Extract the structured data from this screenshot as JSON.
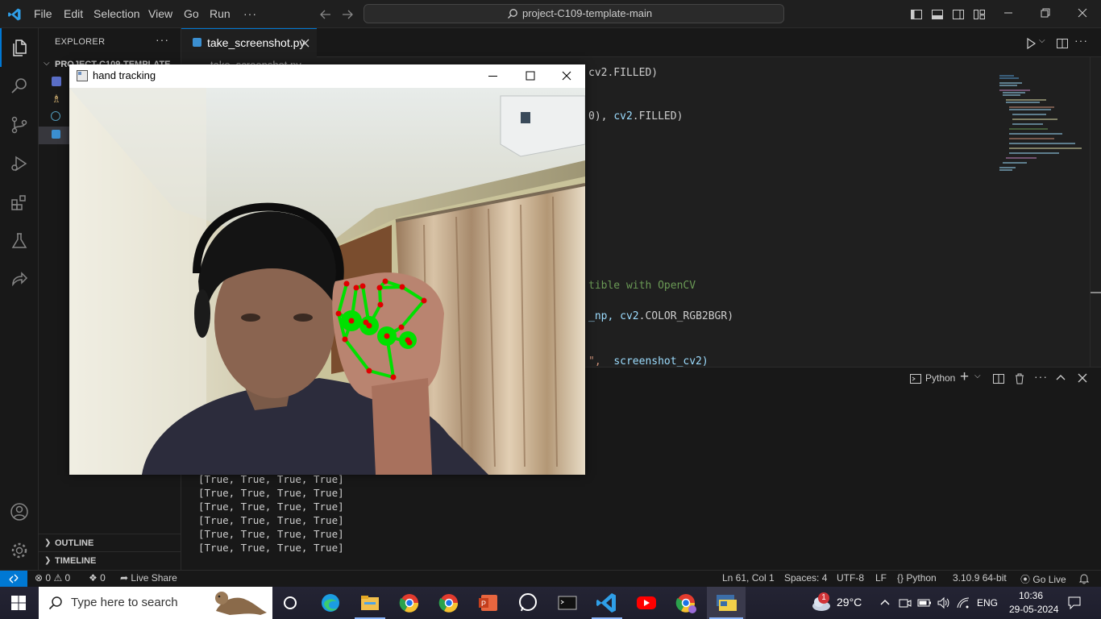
{
  "titlebar": {
    "menu": [
      "File",
      "Edit",
      "Selection",
      "View",
      "Go",
      "Run",
      "···"
    ],
    "search_text": "project-C109-template-main"
  },
  "sidebar": {
    "header": "EXPLORER",
    "project": "PROJECT-C109-TEMPLATE",
    "sections": [
      "OUTLINE",
      "TIMELINE"
    ]
  },
  "editor": {
    "tab_label": "take_screenshot.py",
    "breadcrumb": "take_screenshot.py",
    "code_lines": [
      {
        "segments": [
          {
            "text": "0), ",
            "color": "#cccccc"
          },
          {
            "text": "cv2",
            "color": "#9cdcfe"
          },
          {
            "text": ".FILLED)",
            "color": "#cccccc"
          }
        ]
      },
      {
        "segments": [
          {
            "text": "tible with OpenCV",
            "color": "#6a9955"
          }
        ]
      },
      {
        "segments": [
          {
            "text": "_np, ",
            "color": "#9cdcfe"
          },
          {
            "text": "cv2",
            "color": "#9cdcfe"
          },
          {
            "text": ".COLOR_RGB2BGR)",
            "color": "#cccccc"
          }
        ]
      },
      {
        "segments": [
          {
            "text": "\",  ",
            "color": "#ce9178"
          },
          {
            "text": "screenshot_cv2)",
            "color": "#9cdcfe"
          }
        ]
      }
    ]
  },
  "panel": {
    "terminal_kind": "Python",
    "lines": [
      "[True, True, True, True]",
      "[True, True, True, True]",
      "[True, True, True, True]",
      "[True, True, True, True]",
      "[True, True, True, True]",
      "[True, True, True, True]"
    ]
  },
  "statusbar": {
    "errors": "0",
    "warnings": "0",
    "ports": "0",
    "live_share": "Live Share",
    "position": "Ln 61, Col 1",
    "spaces": "Spaces: 4",
    "encoding": "UTF-8",
    "eol": "LF",
    "language": "Python",
    "interpreter": "3.10.9 64-bit",
    "go_live": "Go Live"
  },
  "cv_window": {
    "title": "hand tracking"
  },
  "taskbar": {
    "search_placeholder": "Type here to search",
    "weather": "29°C",
    "weather_badge": "1",
    "language": "ENG",
    "time": "10:36",
    "date": "29-05-2024"
  },
  "colors": {
    "accent": "#0078d4",
    "landmark_line": "#00e000",
    "landmark_point": "#e00000"
  }
}
